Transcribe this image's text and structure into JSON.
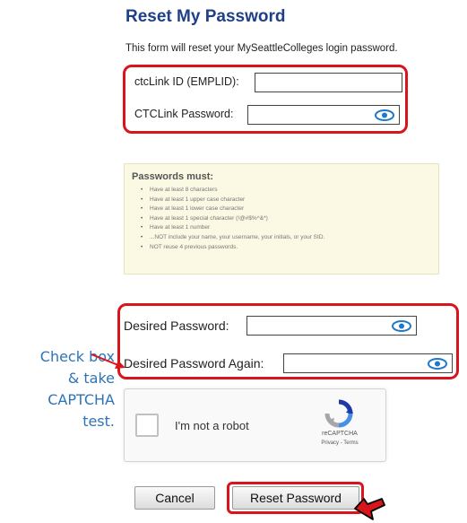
{
  "title": "Reset My Password",
  "intro": "This form will reset your MySeattleColleges login password.",
  "login_fields": {
    "emplid_label": "ctcLink ID (EMPLID):",
    "emplid_value": "",
    "password_label": "CTCLink Password:",
    "password_value": ""
  },
  "rules": {
    "heading": "Passwords must:",
    "items": [
      "Have at least 8 characters",
      "Have at least 1 upper case character",
      "Have at least 1 lower case character",
      "Have at least 1 special character (!@#$%^&*)",
      "Have at least 1 number",
      "...NOT include your name, your username, your initials, or your SID.",
      "NOT reuse 4 previous passwords."
    ]
  },
  "new_password": {
    "desired_label": "Desired Password:",
    "desired_value": "",
    "again_label": "Desired Password Again:",
    "again_value": ""
  },
  "callout": {
    "lines": [
      "Check box",
      "& take",
      "CAPTCHA",
      "test."
    ]
  },
  "captcha": {
    "checkbox_label": "I'm not a robot",
    "brand": "reCAPTCHA",
    "links": "Privacy - Terms",
    "checked": false
  },
  "buttons": {
    "cancel": "Cancel",
    "reset": "Reset Password"
  },
  "colors": {
    "title": "#1f3f86",
    "highlight": "#d9141b",
    "callout": "#2e74b5",
    "eye_icon": "#1f78c8"
  }
}
